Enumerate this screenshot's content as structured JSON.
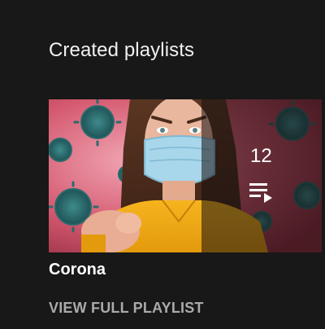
{
  "section": {
    "title": "Created playlists"
  },
  "playlist": {
    "title": "Corona",
    "video_count": "12",
    "view_full_label": "VIEW FULL PLAYLIST",
    "thumbnail_icon": "playlist-play-icon"
  },
  "colors": {
    "background": "#181818",
    "primary_text": "#ffffff",
    "secondary_text": "#aaaaaa"
  }
}
